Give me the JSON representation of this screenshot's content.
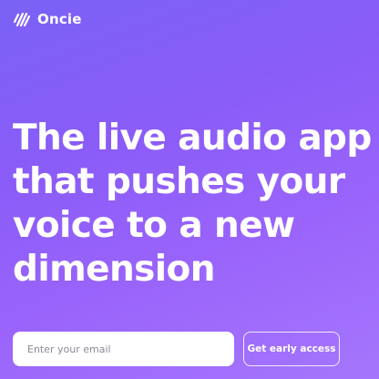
{
  "brand": {
    "name": "Oncie",
    "logo_icon": "oncie-logo-icon"
  },
  "hero": {
    "lines": [
      "The live audio app",
      "that pushes your",
      "voice to a new",
      "dimension"
    ]
  },
  "signup": {
    "email_placeholder": "Enter your email",
    "email_value": "",
    "submit_label": "Get early access"
  },
  "colors": {
    "background_start": "#7a62f5",
    "background_end": "#a576fc",
    "text": "#ffffff",
    "input_background": "#ffffff"
  }
}
